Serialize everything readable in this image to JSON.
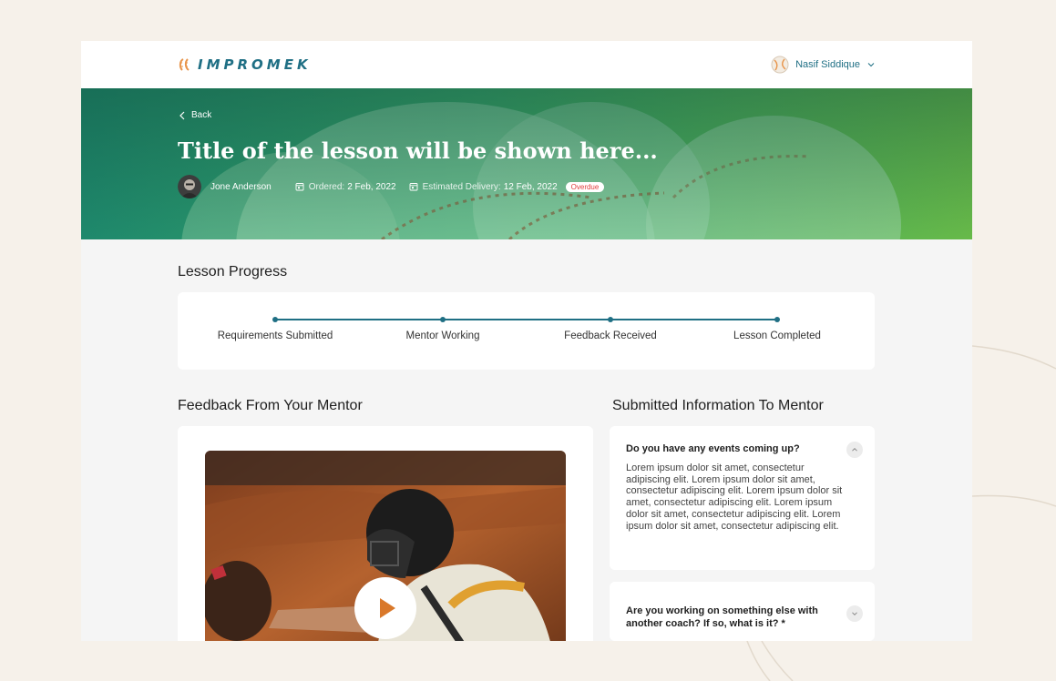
{
  "app": {
    "brand": "IMPROMEK",
    "user_name": "Nasif Siddique"
  },
  "hero": {
    "back_label": "Back",
    "title": "Title of the lesson will be shown here...",
    "mentor_name": "Jone Anderson",
    "ordered_label": "Ordered:",
    "ordered_date": "2 Feb, 2022",
    "delivery_label": "Estimated Delivery:",
    "delivery_date": "12 Feb, 2022",
    "status_badge": "Overdue"
  },
  "progress": {
    "heading": "Lesson Progress",
    "steps": [
      {
        "label": "Requirements Submitted"
      },
      {
        "label": "Mentor Working"
      },
      {
        "label": "Feedback Received"
      },
      {
        "label": "Lesson Completed"
      }
    ]
  },
  "feedback": {
    "heading": "Feedback From Your Mentor",
    "video_icon": "play-icon"
  },
  "submitted": {
    "heading": "Submitted Information To Mentor",
    "items": [
      {
        "question": "Do you have any events coming up?",
        "answer": "Lorem ipsum dolor sit amet, consectetur adipiscing elit. Lorem ipsum dolor sit amet, consectetur adipiscing elit. Lorem ipsum dolor sit amet, consectetur adipiscing elit. Lorem ipsum dolor sit amet, consectetur adipiscing elit. Lorem ipsum dolor sit amet, consectetur adipiscing elit.",
        "expanded": true
      },
      {
        "question": "Are you working on something else with another coach? If so, what is it? *",
        "expanded": false
      }
    ]
  },
  "colors": {
    "brand": "#1f6f84",
    "progress_line": "#1f6f84",
    "overdue": "#e03a3a",
    "page_bg": "#f6f1ea",
    "hero_green": "#4aa85a"
  }
}
